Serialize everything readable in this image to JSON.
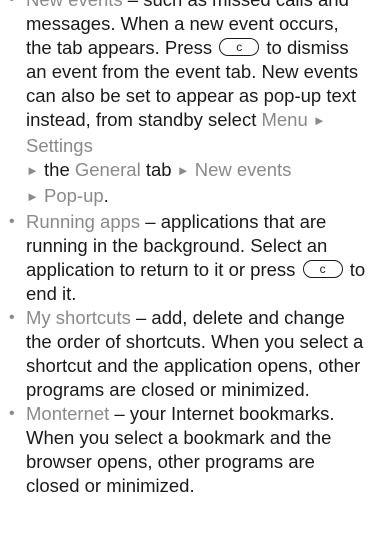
{
  "items": [
    {
      "term": "New events",
      "text1": " – such as missed calls and messages. When a new event occurs, the tab appears. Press ",
      "key": "c",
      "text2": " to dismiss an event from the event tab. New events can also be set to appear as pop-up text instead, from standby select ",
      "menu": "Menu",
      "settings": "Settings",
      "the": "the",
      "general": "General",
      "tab": "tab",
      "new_events": "New events",
      "popup": "Pop-up",
      "end": "."
    },
    {
      "term": "Running apps",
      "text1": " – applications that are running in the background. Select an application to return to it or press ",
      "key": "c",
      "text2": " to end it."
    },
    {
      "term": "My shortcuts",
      "text1": " – add, delete and change the order of shortcuts. When you select a shortcut and the application opens, other programs are closed or minimized."
    },
    {
      "term": "Monternet",
      "text1": " – your Internet bookmarks. When you select a bookmark and the browser opens, other programs are closed or minimized."
    }
  ]
}
